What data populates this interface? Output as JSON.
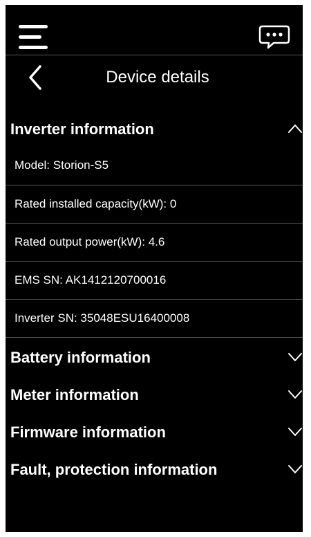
{
  "header": {
    "menu_icon": "hamburger-menu-icon",
    "chat_icon": "chat-bubble-icon"
  },
  "nav": {
    "back_icon": "chevron-left-icon",
    "title": "Device details"
  },
  "sections": {
    "inverter": {
      "title": "Inverter information",
      "expanded": true,
      "chevron": "chevron-up-icon",
      "rows": [
        "Model: Storion-S5",
        "Rated installed capacity(kW): 0",
        "Rated output power(kW): 4.6",
        "EMS SN: AK1412120700016",
        "Inverter SN: 35048ESU16400008"
      ]
    },
    "battery": {
      "title": "Battery information",
      "expanded": false,
      "chevron": "chevron-down-icon"
    },
    "meter": {
      "title": "Meter information",
      "expanded": false,
      "chevron": "chevron-down-icon"
    },
    "firmware": {
      "title": "Firmware information",
      "expanded": false,
      "chevron": "chevron-down-icon"
    },
    "fault": {
      "title": "Fault, protection information",
      "expanded": false,
      "chevron": "chevron-down-icon"
    }
  },
  "colors": {
    "background": "#000000",
    "text": "#ffffff",
    "divider": "#5a5a5a",
    "page_border": "#ffffff"
  }
}
